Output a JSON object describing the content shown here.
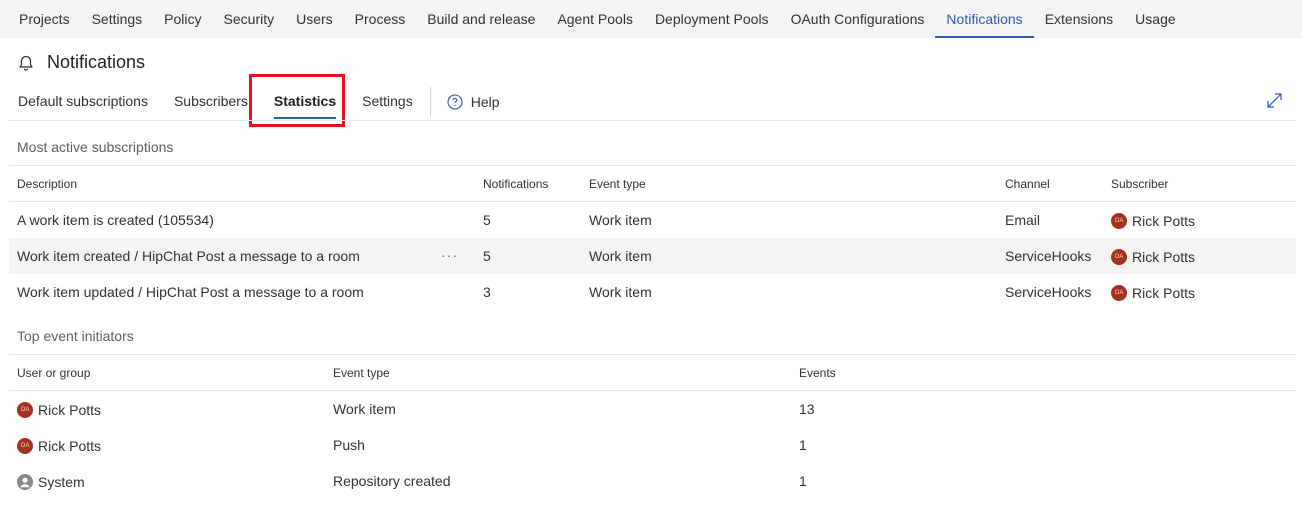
{
  "top_nav": {
    "items": [
      {
        "label": "Projects"
      },
      {
        "label": "Settings"
      },
      {
        "label": "Policy"
      },
      {
        "label": "Security"
      },
      {
        "label": "Users"
      },
      {
        "label": "Process"
      },
      {
        "label": "Build and release"
      },
      {
        "label": "Agent Pools"
      },
      {
        "label": "Deployment Pools"
      },
      {
        "label": "OAuth Configurations"
      },
      {
        "label": "Notifications",
        "active": true
      },
      {
        "label": "Extensions"
      },
      {
        "label": "Usage"
      }
    ]
  },
  "page": {
    "title": "Notifications",
    "icon": "bell-icon"
  },
  "tabs": {
    "items": [
      {
        "label": "Default subscriptions"
      },
      {
        "label": "Subscribers"
      },
      {
        "label": "Statistics",
        "active": true
      },
      {
        "label": "Settings"
      }
    ],
    "help_label": "Help",
    "highlight_color": "#e81123"
  },
  "colors": {
    "accent": "#2b5bb5",
    "avatar": "#a4321e",
    "row_highlight": "#f4f4f4"
  },
  "subscriptions": {
    "title": "Most active subscriptions",
    "headers": {
      "description": "Description",
      "notifications": "Notifications",
      "event_type": "Event type",
      "channel": "Channel",
      "subscriber": "Subscriber"
    },
    "rows": [
      {
        "description": "A work item is created (105534)",
        "notifications": "5",
        "event_type": "Work item",
        "channel": "Email",
        "subscriber": "Rick Potts"
      },
      {
        "description": "Work item created / HipChat Post a message to a room",
        "notifications": "5",
        "event_type": "Work item",
        "channel": "ServiceHooks",
        "subscriber": "Rick Potts",
        "more": "···"
      },
      {
        "description": "Work item updated / HipChat Post a message to a room",
        "notifications": "3",
        "event_type": "Work item",
        "channel": "ServiceHooks",
        "subscriber": "Rick Potts"
      }
    ]
  },
  "initiators": {
    "title": "Top event initiators",
    "headers": {
      "user": "User or group",
      "event_type": "Event type",
      "events": "Events"
    },
    "rows": [
      {
        "user": "Rick Potts",
        "event_type": "Work item",
        "events": "13"
      },
      {
        "user": "Rick Potts",
        "event_type": "Push",
        "events": "1"
      },
      {
        "user": "System",
        "event_type": "Repository created",
        "events": "1"
      }
    ]
  }
}
